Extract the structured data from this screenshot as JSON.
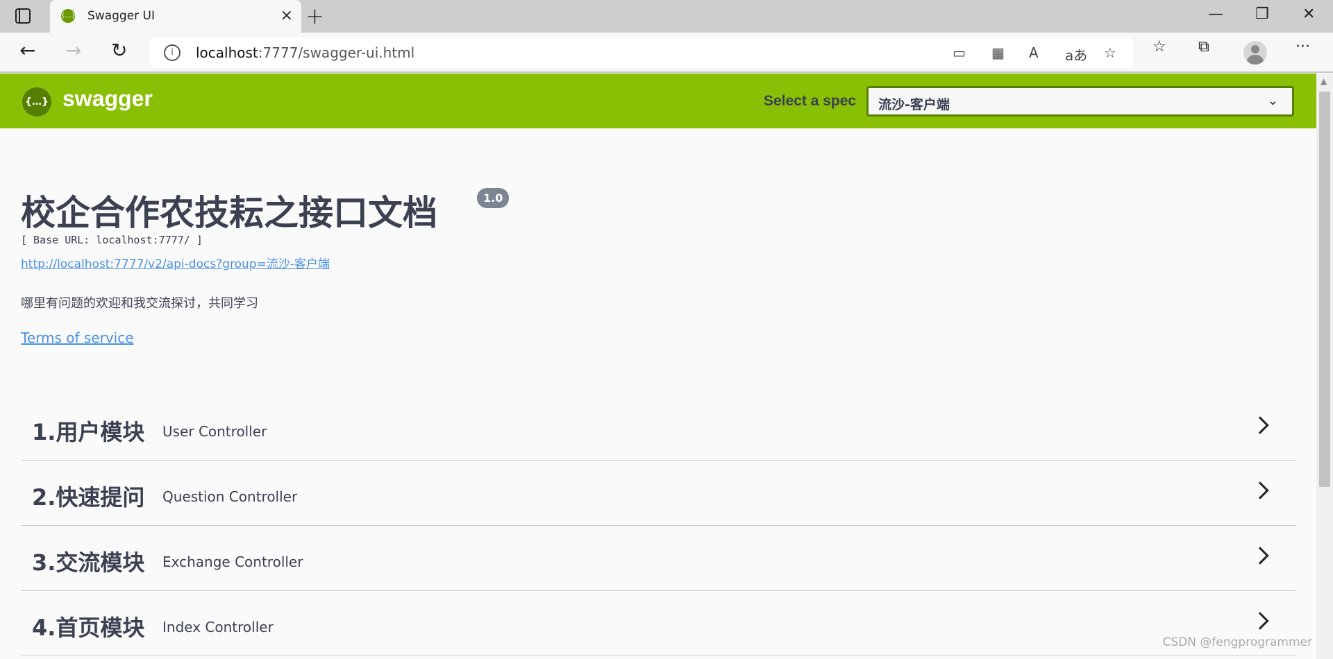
{
  "browser": {
    "tab_title": "Swagger UI",
    "url_host": "localhost",
    "url_rest": ":7777/swagger-ui.html"
  },
  "header": {
    "brand": "swagger",
    "logo_glyph": "{…}",
    "spec_label": "Select a spec",
    "spec_value": "流沙-客户端",
    "accent_color": "#89bf04"
  },
  "info": {
    "title": "校企合作农技耘之接口文档",
    "version": "1.0",
    "base_url": "[ Base URL: localhost:7777/ ]",
    "api_docs_link": "http://localhost:7777/v2/api-docs?group=流沙-客户端",
    "description": "哪里有问题的欢迎和我交流探讨，共同学习",
    "terms": "Terms of service"
  },
  "tags": [
    {
      "name": "1.用户模块",
      "desc": "User Controller"
    },
    {
      "name": "2.快速提问",
      "desc": "Question Controller"
    },
    {
      "name": "3.交流模块",
      "desc": "Exchange Controller"
    },
    {
      "name": "4.首页模块",
      "desc": "Index Controller"
    }
  ],
  "watermark": "CSDN @fengprogrammer"
}
